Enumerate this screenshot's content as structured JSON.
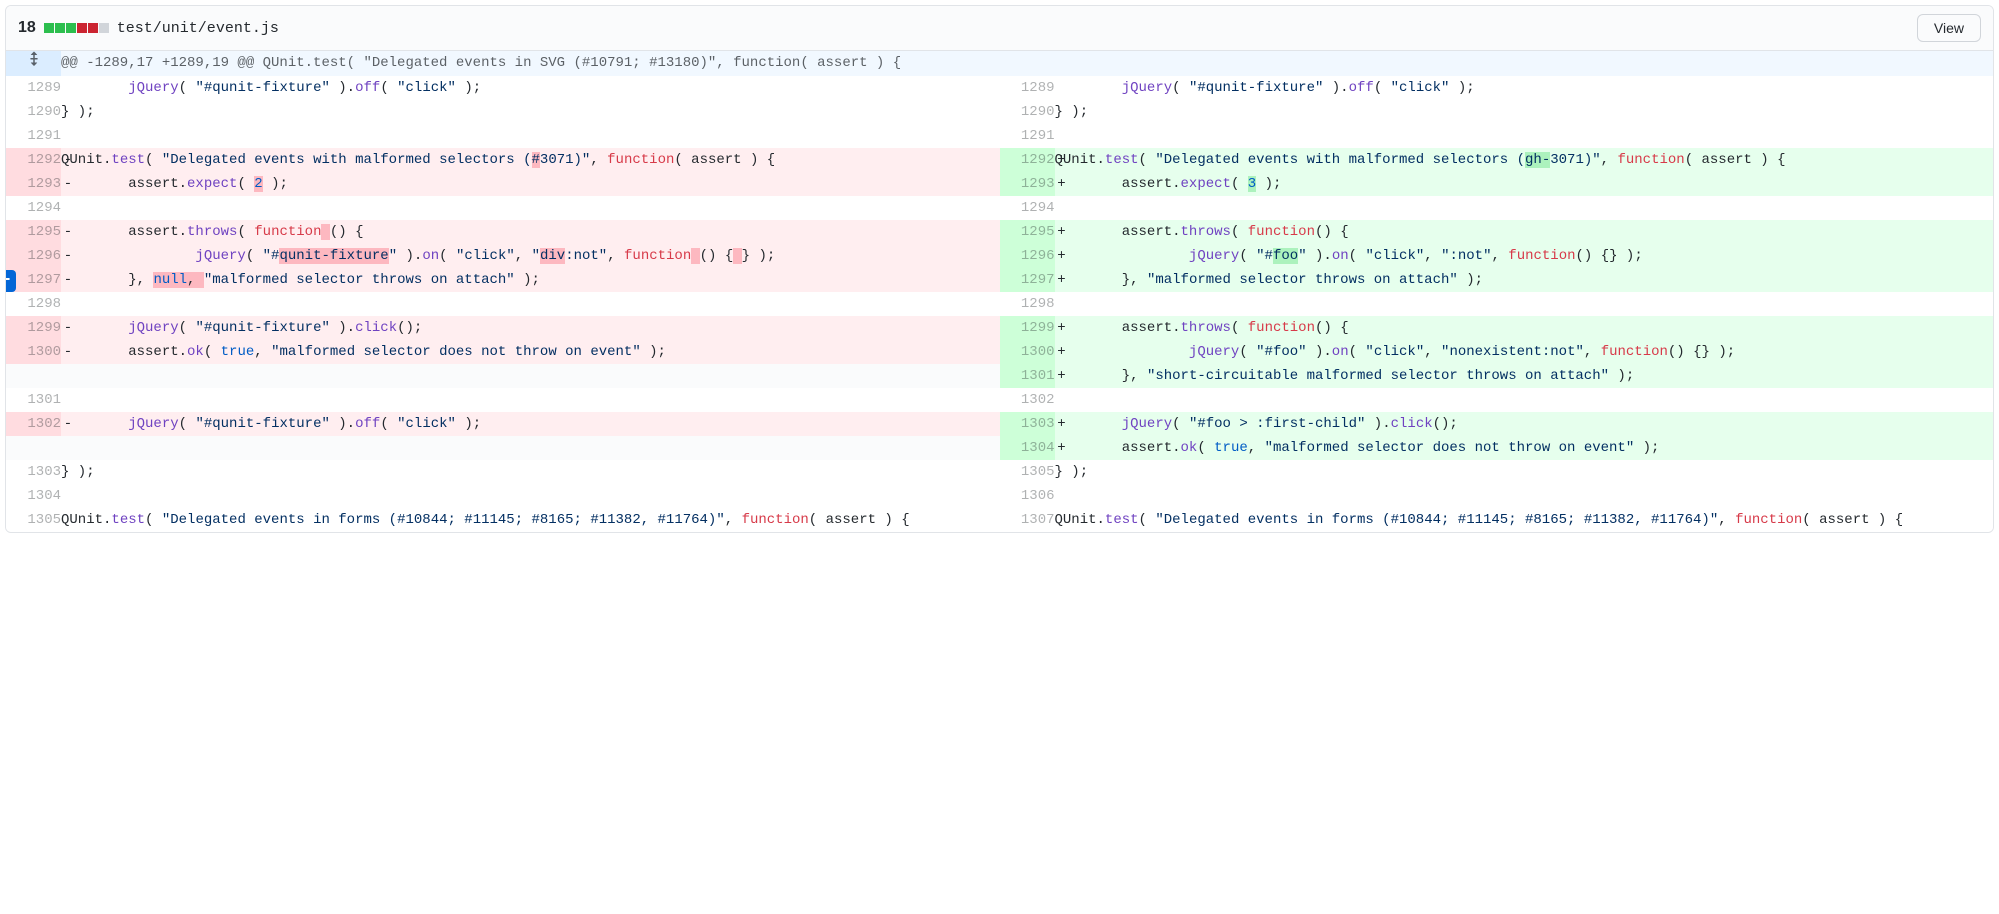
{
  "header": {
    "diff_count": "18",
    "blocks": [
      "add",
      "add",
      "add",
      "del",
      "del",
      "neutral"
    ],
    "file_path": "test/unit/event.js",
    "view_btn": "View"
  },
  "hunk": "@@ -1289,17 +1289,19 @@ QUnit.test( \"Delegated events in SVG (#10791; #13180)\", function( assert ) {",
  "rows": [
    {
      "l": "1289",
      "r": "1289",
      "lt": "ctx",
      "rt": "ctx",
      "lc": [
        {
          "t": "        "
        },
        {
          "t": "jQuery",
          "c": "tok-fn"
        },
        {
          "t": "( "
        },
        {
          "t": "\"#qunit-fixture\"",
          "c": "tok-str"
        },
        {
          "t": " )."
        },
        {
          "t": "off",
          "c": "tok-fn"
        },
        {
          "t": "( "
        },
        {
          "t": "\"click\"",
          "c": "tok-str"
        },
        {
          "t": " );"
        }
      ]
    },
    {
      "l": "1290",
      "r": "1290",
      "lt": "ctx",
      "rt": "ctx",
      "lc": [
        {
          "t": "} );"
        }
      ]
    },
    {
      "l": "1291",
      "r": "1291",
      "lt": "ctx",
      "rt": "ctx",
      "lc": [
        {
          "t": ""
        }
      ]
    },
    {
      "l": "1292",
      "r": "1292",
      "lt": "del",
      "rt": "add",
      "lm": "-",
      "rm": "+",
      "lc": [
        {
          "t": "QUnit"
        },
        {
          "t": ".",
          "c": ""
        },
        {
          "t": "test",
          "c": "tok-fn"
        },
        {
          "t": "( "
        },
        {
          "t": "\"Delegated events with malformed selectors (",
          "c": "tok-str"
        },
        {
          "t": "#",
          "c": "tok-str hl-del"
        },
        {
          "t": "3071)\"",
          "c": "tok-str"
        },
        {
          "t": ", "
        },
        {
          "t": "function",
          "c": "tok-kw"
        },
        {
          "t": "( assert ) {"
        }
      ],
      "rc": [
        {
          "t": "QUnit"
        },
        {
          "t": ".",
          "c": ""
        },
        {
          "t": "test",
          "c": "tok-fn"
        },
        {
          "t": "( "
        },
        {
          "t": "\"Delegated events with malformed selectors (",
          "c": "tok-str"
        },
        {
          "t": "gh-",
          "c": "tok-str hl-add"
        },
        {
          "t": "3071)\"",
          "c": "tok-str"
        },
        {
          "t": ", "
        },
        {
          "t": "function",
          "c": "tok-kw"
        },
        {
          "t": "( assert ) {"
        }
      ]
    },
    {
      "l": "1293",
      "r": "1293",
      "lt": "del",
      "rt": "add",
      "lm": "-",
      "rm": "+",
      "lc": [
        {
          "t": "        assert."
        },
        {
          "t": "expect",
          "c": "tok-fn"
        },
        {
          "t": "( "
        },
        {
          "t": "2",
          "c": "tok-lit hl-del"
        },
        {
          "t": " );"
        }
      ],
      "rc": [
        {
          "t": "        assert."
        },
        {
          "t": "expect",
          "c": "tok-fn"
        },
        {
          "t": "( "
        },
        {
          "t": "3",
          "c": "tok-lit hl-add"
        },
        {
          "t": " );"
        }
      ]
    },
    {
      "l": "1294",
      "r": "1294",
      "lt": "ctx",
      "rt": "ctx",
      "lc": [
        {
          "t": ""
        }
      ]
    },
    {
      "l": "1295",
      "r": "1295",
      "lt": "del",
      "rt": "add",
      "lm": "-",
      "rm": "+",
      "lc": [
        {
          "t": "        assert."
        },
        {
          "t": "throws",
          "c": "tok-fn"
        },
        {
          "t": "( "
        },
        {
          "t": "function",
          "c": "tok-kw"
        },
        {
          "t": " ",
          "c": "hl-del"
        },
        {
          "t": "() {"
        }
      ],
      "rc": [
        {
          "t": "        assert."
        },
        {
          "t": "throws",
          "c": "tok-fn"
        },
        {
          "t": "( "
        },
        {
          "t": "function",
          "c": "tok-kw"
        },
        {
          "t": "() {"
        }
      ]
    },
    {
      "l": "1296",
      "r": "1296",
      "lt": "del",
      "rt": "add",
      "lm": "-",
      "rm": "+",
      "lc": [
        {
          "t": "                "
        },
        {
          "t": "jQuery",
          "c": "tok-fn"
        },
        {
          "t": "( "
        },
        {
          "t": "\"#",
          "c": "tok-str"
        },
        {
          "t": "qunit-fixture",
          "c": "tok-str hl-del"
        },
        {
          "t": "\"",
          "c": "tok-str"
        },
        {
          "t": " )."
        },
        {
          "t": "on",
          "c": "tok-fn"
        },
        {
          "t": "( "
        },
        {
          "t": "\"click\"",
          "c": "tok-str"
        },
        {
          "t": ", "
        },
        {
          "t": "\"",
          "c": "tok-str"
        },
        {
          "t": "div",
          "c": "tok-str hl-del"
        },
        {
          "t": ":not\"",
          "c": "tok-str"
        },
        {
          "t": ", "
        },
        {
          "t": "function",
          "c": "tok-kw"
        },
        {
          "t": " ",
          "c": "hl-del"
        },
        {
          "t": "() {"
        },
        {
          "t": " ",
          "c": "hl-del"
        },
        {
          "t": "} );"
        }
      ],
      "rc": [
        {
          "t": "                "
        },
        {
          "t": "jQuery",
          "c": "tok-fn"
        },
        {
          "t": "( "
        },
        {
          "t": "\"#",
          "c": "tok-str"
        },
        {
          "t": "foo",
          "c": "tok-str hl-add"
        },
        {
          "t": "\"",
          "c": "tok-str"
        },
        {
          "t": " )."
        },
        {
          "t": "on",
          "c": "tok-fn"
        },
        {
          "t": "( "
        },
        {
          "t": "\"click\"",
          "c": "tok-str"
        },
        {
          "t": ", "
        },
        {
          "t": "\":not\"",
          "c": "tok-str"
        },
        {
          "t": ", "
        },
        {
          "t": "function",
          "c": "tok-kw"
        },
        {
          "t": "() {} );"
        }
      ]
    },
    {
      "l": "1297",
      "r": "1297",
      "lt": "del",
      "rt": "add",
      "lm": "-",
      "rm": "+",
      "addbtn": true,
      "lc": [
        {
          "t": "        }, "
        },
        {
          "t": "null",
          "c": "tok-lit hl-del"
        },
        {
          "t": ", ",
          "c": "hl-del"
        },
        {
          "t": "\"malformed selector throws on attach\"",
          "c": "tok-str"
        },
        {
          "t": " );"
        }
      ],
      "rc": [
        {
          "t": "        }, "
        },
        {
          "t": "\"malformed selector throws on attach\"",
          "c": "tok-str"
        },
        {
          "t": " );"
        }
      ]
    },
    {
      "l": "1298",
      "r": "1298",
      "lt": "ctx",
      "rt": "ctx",
      "lc": [
        {
          "t": ""
        }
      ]
    },
    {
      "l": "1299",
      "r": "1299",
      "lt": "del",
      "rt": "add",
      "lm": "-",
      "rm": "+",
      "lc": [
        {
          "t": "        "
        },
        {
          "t": "jQuery",
          "c": "tok-fn"
        },
        {
          "t": "( "
        },
        {
          "t": "\"#qunit-fixture\"",
          "c": "tok-str"
        },
        {
          "t": " )."
        },
        {
          "t": "click",
          "c": "tok-fn"
        },
        {
          "t": "();"
        }
      ],
      "rc": [
        {
          "t": "        assert."
        },
        {
          "t": "throws",
          "c": "tok-fn"
        },
        {
          "t": "( "
        },
        {
          "t": "function",
          "c": "tok-kw"
        },
        {
          "t": "() {"
        }
      ]
    },
    {
      "l": "1300",
      "r": "1300",
      "lt": "del",
      "rt": "add",
      "lm": "-",
      "rm": "+",
      "lc": [
        {
          "t": "        assert."
        },
        {
          "t": "ok",
          "c": "tok-fn"
        },
        {
          "t": "( "
        },
        {
          "t": "true",
          "c": "tok-lit"
        },
        {
          "t": ", "
        },
        {
          "t": "\"malformed selector does not throw on event\"",
          "c": "tok-str"
        },
        {
          "t": " );"
        }
      ],
      "rc": [
        {
          "t": "                "
        },
        {
          "t": "jQuery",
          "c": "tok-fn"
        },
        {
          "t": "( "
        },
        {
          "t": "\"#foo\"",
          "c": "tok-str"
        },
        {
          "t": " )."
        },
        {
          "t": "on",
          "c": "tok-fn"
        },
        {
          "t": "( "
        },
        {
          "t": "\"click\"",
          "c": "tok-str"
        },
        {
          "t": ", "
        },
        {
          "t": "\"nonexistent:not\"",
          "c": "tok-str"
        },
        {
          "t": ", "
        },
        {
          "t": "function",
          "c": "tok-kw"
        },
        {
          "t": "() {} );"
        }
      ]
    },
    {
      "l": "",
      "r": "1301",
      "lt": "empty",
      "rt": "add",
      "rm": "+",
      "lc": null,
      "rc": [
        {
          "t": "        }, "
        },
        {
          "t": "\"short-circuitable malformed selector throws on attach\"",
          "c": "tok-str"
        },
        {
          "t": " );"
        }
      ]
    },
    {
      "l": "1301",
      "r": "1302",
      "lt": "ctx",
      "rt": "ctx",
      "lc": [
        {
          "t": ""
        }
      ]
    },
    {
      "l": "1302",
      "r": "1303",
      "lt": "del",
      "rt": "add",
      "lm": "-",
      "rm": "+",
      "lc": [
        {
          "t": "        "
        },
        {
          "t": "jQuery",
          "c": "tok-fn"
        },
        {
          "t": "( "
        },
        {
          "t": "\"#qunit-fixture\"",
          "c": "tok-str"
        },
        {
          "t": " )."
        },
        {
          "t": "off",
          "c": "tok-fn"
        },
        {
          "t": "( "
        },
        {
          "t": "\"click\"",
          "c": "tok-str"
        },
        {
          "t": " );"
        }
      ],
      "rc": [
        {
          "t": "        "
        },
        {
          "t": "jQuery",
          "c": "tok-fn"
        },
        {
          "t": "( "
        },
        {
          "t": "\"#foo > :first-child\"",
          "c": "tok-str"
        },
        {
          "t": " )."
        },
        {
          "t": "click",
          "c": "tok-fn"
        },
        {
          "t": "();"
        }
      ]
    },
    {
      "l": "",
      "r": "1304",
      "lt": "empty",
      "rt": "add",
      "rm": "+",
      "lc": null,
      "rc": [
        {
          "t": "        assert."
        },
        {
          "t": "ok",
          "c": "tok-fn"
        },
        {
          "t": "( "
        },
        {
          "t": "true",
          "c": "tok-lit"
        },
        {
          "t": ", "
        },
        {
          "t": "\"malformed selector does not throw on event\"",
          "c": "tok-str"
        },
        {
          "t": " );"
        }
      ]
    },
    {
      "l": "1303",
      "r": "1305",
      "lt": "ctx",
      "rt": "ctx",
      "lc": [
        {
          "t": "} );"
        }
      ]
    },
    {
      "l": "1304",
      "r": "1306",
      "lt": "ctx",
      "rt": "ctx",
      "lc": [
        {
          "t": ""
        }
      ]
    },
    {
      "l": "1305",
      "r": "1307",
      "lt": "ctx",
      "rt": "ctx",
      "lc": [
        {
          "t": "QUnit."
        },
        {
          "t": "test",
          "c": "tok-fn"
        },
        {
          "t": "( "
        },
        {
          "t": "\"Delegated events in forms (#10844; #11145; #8165; #11382, #11764)\"",
          "c": "tok-str"
        },
        {
          "t": ", "
        },
        {
          "t": "function",
          "c": "tok-kw"
        },
        {
          "t": "( assert ) {"
        }
      ]
    }
  ]
}
